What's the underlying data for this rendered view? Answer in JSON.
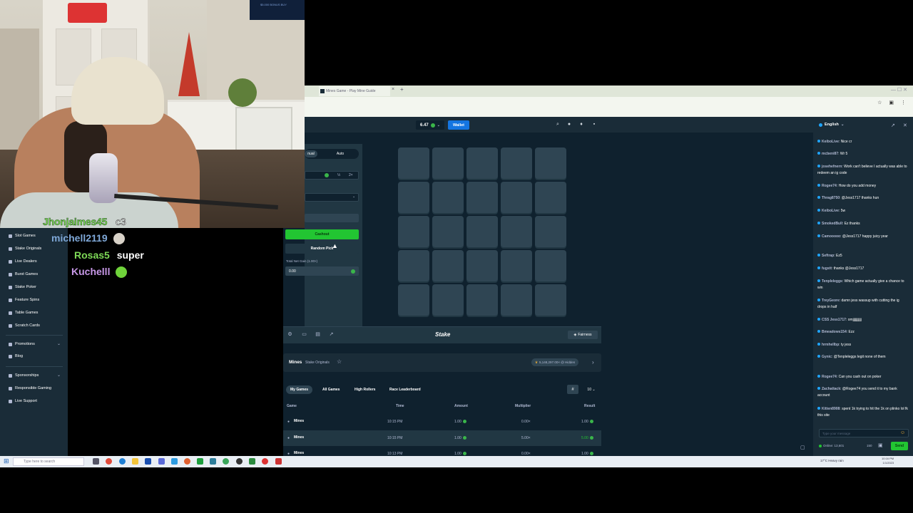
{
  "browser": {
    "tab_title": "Mines Game - Play Mine Guide",
    "tab_close": "×"
  },
  "topnav": {
    "balance": "6.47",
    "wallet_label": "Wallet"
  },
  "sidebar": {
    "items": [
      {
        "label": "Slot Games"
      },
      {
        "label": "Stake Originals"
      },
      {
        "label": "Live Dealers"
      },
      {
        "label": "Burst Games"
      },
      {
        "label": "Stake Poker"
      },
      {
        "label": "Feature Spins"
      },
      {
        "label": "Table Games"
      },
      {
        "label": "Scratch Cards"
      }
    ],
    "promotions": "Promotions",
    "blog": "Blog",
    "sponsorships": "Sponsorships",
    "responsible_gaming": "Responsible Gaming",
    "live_support": "Live Support"
  },
  "stream_overlay": {
    "highlight_user": "Jhonjaimes45",
    "highlight_msg": "c3",
    "messages": [
      {
        "user": "michell2119",
        "color": "#7fa8d8",
        "text": ""
      },
      {
        "user": "Rosas5",
        "color": "#7ed957",
        "text": "super"
      },
      {
        "user": "Kuchelll",
        "color": "#c898e8",
        "text": ""
      }
    ],
    "tv_text": "$5.000 BONUS BUY"
  },
  "game_panel": {
    "mode_manual": "nual",
    "mode_auto": "Auto",
    "half_label": "½",
    "double_label": "2×",
    "cashout_label": "Cashout",
    "random_pick_label": "Random Pick",
    "net_gain_label": "Total Net Gain (1.00×)",
    "net_gain_value": "0.00"
  },
  "board": {
    "rows": 5,
    "cols": 5
  },
  "game_footer": {
    "logo": "Stake",
    "fairness_label": "Fairness"
  },
  "game_info": {
    "title": "Mines",
    "subtitle": "Stake Originals",
    "badge": "5,148,297.00× @ Hidden"
  },
  "bets": {
    "tabs": [
      "My Games",
      "All Games",
      "High Rollers",
      "Race Leaderboard"
    ],
    "count": "10",
    "columns": [
      "Game",
      "Time",
      "Amount",
      "Multiplier",
      "Result"
    ],
    "rows": [
      {
        "game": "Mines",
        "time": "10:15 PM",
        "amount": "1.00",
        "multiplier": "0.00×",
        "result": "1.00",
        "result_color": "#b1bad3"
      },
      {
        "game": "Mines",
        "time": "10:15 PM",
        "amount": "1.00",
        "multiplier": "5.00×",
        "result": "5.00",
        "result_color": "#22c532"
      },
      {
        "game": "Mines",
        "time": "10:13 PM",
        "amount": "1.00",
        "multiplier": "0.00×",
        "result": "1.00",
        "result_color": "#b1bad3"
      }
    ]
  },
  "chat": {
    "language": "English",
    "messages": [
      {
        "user": "KeiboLive",
        "text": "Nice cr"
      },
      {
        "user": "mcbeni87",
        "text": "Wr 5"
      },
      {
        "user": "josehefnern",
        "text": "Work can't believe I actually was able to redeem an ig code"
      },
      {
        "user": "Rogee74",
        "text": "How do you add money"
      },
      {
        "user": "Thrag8750",
        "text": "@Jess1717 thanks hun"
      },
      {
        "user": "KeiboLive",
        "text": "5w"
      },
      {
        "user": "SmokedBull",
        "text": "Ez thanks"
      },
      {
        "user": "Camooooo",
        "text": "@Jess1717 happy juicy year"
      },
      {
        "user": "Seftrap",
        "text": "Ez5"
      },
      {
        "user": "fugstt",
        "text": "thanks @Jess1717"
      },
      {
        "user": "Tenpleleggs",
        "text": "Which game actually give a chance to win"
      },
      {
        "user": "TreyGeore",
        "text": "damn jess wassup with cutting the ig drops in half"
      },
      {
        "user": "CSS Jess1717",
        "text": "omjjjjjjjjjjj"
      },
      {
        "user": "Bmeadows154",
        "text": "Ezz"
      },
      {
        "user": "hrmhellbp",
        "text": "ty jess"
      },
      {
        "user": "Gynic",
        "text": "@Tenpleleggs legit none of them"
      },
      {
        "user": "Rogee74",
        "text": "Can you cash out on poker"
      },
      {
        "user": "Zachattack",
        "text": "@Rogee74 you send it to my bank account"
      },
      {
        "user": "Kitten8908",
        "text": "spent 1k trying to hit the 1k on plinko lol fk this site"
      }
    ],
    "input_placeholder": "Type your message",
    "online": "Online: 13,601",
    "rules": "150",
    "send_label": "Send"
  },
  "taskbar": {
    "search_placeholder": "Type here to search",
    "weather": "17°C Heavy rain",
    "time": "10:16 PM",
    "date": "1/1/2023"
  }
}
